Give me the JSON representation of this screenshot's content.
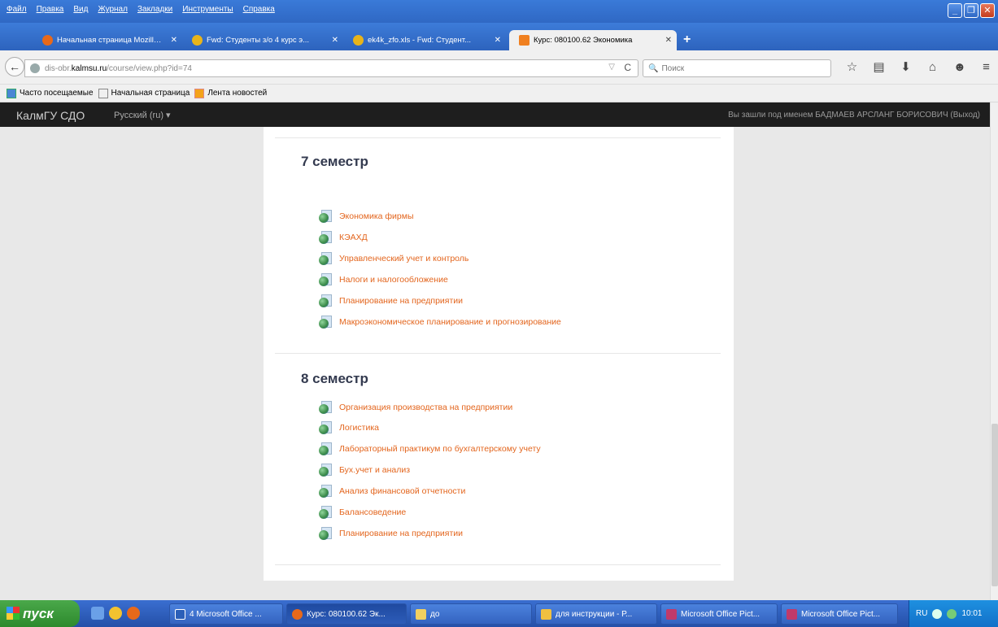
{
  "menubar": [
    "Файл",
    "Правка",
    "Вид",
    "Журнал",
    "Закладки",
    "Инструменты",
    "Справка"
  ],
  "tabs": [
    {
      "label": "Начальная страница Mozilla ...",
      "icon": "firefox-icon",
      "color": "#e8691a"
    },
    {
      "label": "Fwd: Студенты з/о 4 курс э...",
      "icon": "mail-icon",
      "color": "#e8b41a"
    },
    {
      "label": "ek4k_zfo.xls - Fwd: Студент...",
      "icon": "mail-icon",
      "color": "#e8b41a"
    },
    {
      "label": "Курс: 080100.62 Экономика",
      "icon": "moodle-icon",
      "color": "#f08020"
    }
  ],
  "url": {
    "prefix": "dis-obr.",
    "host": "kalmsu.ru",
    "path": "/course/view.php?id=74"
  },
  "search_placeholder": "Поиск",
  "bookmarks": [
    "Часто посещаемые",
    "Начальная страница",
    "Лента новостей"
  ],
  "site": {
    "brand": "КалмГУ СДО",
    "language": "Русский (ru) ▾",
    "user_info": "Вы зашли под именем БАДМАЕВ АРСЛАНГ БОРИСОВИЧ (Выход)"
  },
  "sections": [
    {
      "title": "7 семестр",
      "activities": [
        "Экономика фирмы",
        "КЭАХД",
        "Управленческий учет и контроль",
        "Налоги и налогообложение",
        "Планирование на предприятии",
        "Макроэкономическое планирование и прогнозирование"
      ]
    },
    {
      "title": "8 семестр",
      "activities": [
        "Организация производства на предприятии",
        "Логистика",
        "Лабораторный практикум по бухгалтерскому учету",
        "Бух.учет и анализ",
        "Анализ финансовой отчетности",
        "Балансоведение",
        "Планирование на предприятии"
      ]
    }
  ],
  "taskbar": {
    "start": "пуск",
    "tasks": [
      "4 Microsoft Office ...",
      "Курс: 080100.62 Эк...",
      "до",
      "для инструкции - Р...",
      "Microsoft Office Pict...",
      "Microsoft Office Pict..."
    ],
    "lang": "RU",
    "time": "10:01"
  }
}
